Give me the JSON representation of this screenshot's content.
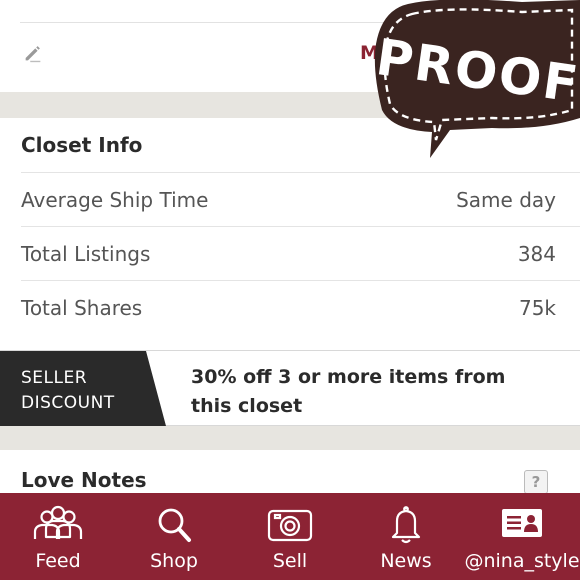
{
  "top": {
    "more_label": "M"
  },
  "closet_info": {
    "title": "Closet Info",
    "rows": [
      {
        "label": "Average Ship Time",
        "value": "Same day"
      },
      {
        "label": "Total Listings",
        "value": "384"
      },
      {
        "label": "Total Shares",
        "value": "75k"
      }
    ]
  },
  "seller_discount": {
    "tag_line1": "SELLER",
    "tag_line2": "DISCOUNT",
    "text": "30% off 3 or more items from this closet"
  },
  "love_notes": {
    "title": "Love Notes",
    "help_icon": "?"
  },
  "bottom_nav": {
    "items": [
      {
        "label": "Feed",
        "icon": "people-icon"
      },
      {
        "label": "Shop",
        "icon": "search-icon"
      },
      {
        "label": "Sell",
        "icon": "camera-icon"
      },
      {
        "label": "News",
        "icon": "bell-icon"
      },
      {
        "label": "@nina_style",
        "icon": "profile-card-icon"
      }
    ]
  },
  "stamp": {
    "text": "PROOF"
  },
  "colors": {
    "brand": "#8c2334",
    "dark": "#2a2a2a",
    "bubble": "#3a2420"
  }
}
